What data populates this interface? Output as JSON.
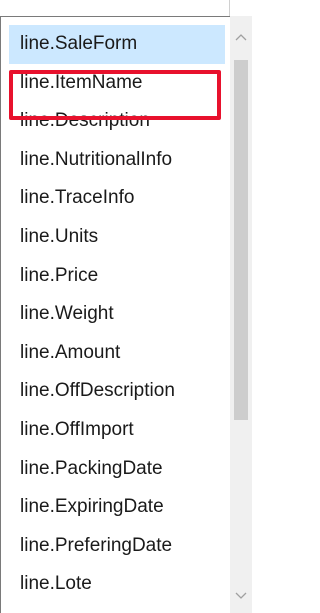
{
  "list": {
    "items": [
      {
        "label": "line.SaleForm"
      },
      {
        "label": "line.ItemName"
      },
      {
        "label": "line.Description"
      },
      {
        "label": "line.NutritionalInfo"
      },
      {
        "label": "line.TraceInfo"
      },
      {
        "label": "line.Units"
      },
      {
        "label": "line.Price"
      },
      {
        "label": "line.Weight"
      },
      {
        "label": "line.Amount"
      },
      {
        "label": "line.OffDescription"
      },
      {
        "label": "line.OffImport"
      },
      {
        "label": "line.PackingDate"
      },
      {
        "label": "line.ExpiringDate"
      },
      {
        "label": "line.PreferingDate"
      },
      {
        "label": "line.Lote"
      }
    ],
    "selected_item": "line.SaleForm",
    "highlighted_item": "line.ItemName"
  },
  "scrollbar": {
    "up_icon": "chevron-up-icon",
    "down_icon": "chevron-down-icon"
  },
  "colors": {
    "selection_bg": "#cce8ff",
    "highlight_border": "#e8112d",
    "scroll_thumb": "#cdcdcd",
    "scroll_track": "#f0f0f0"
  }
}
